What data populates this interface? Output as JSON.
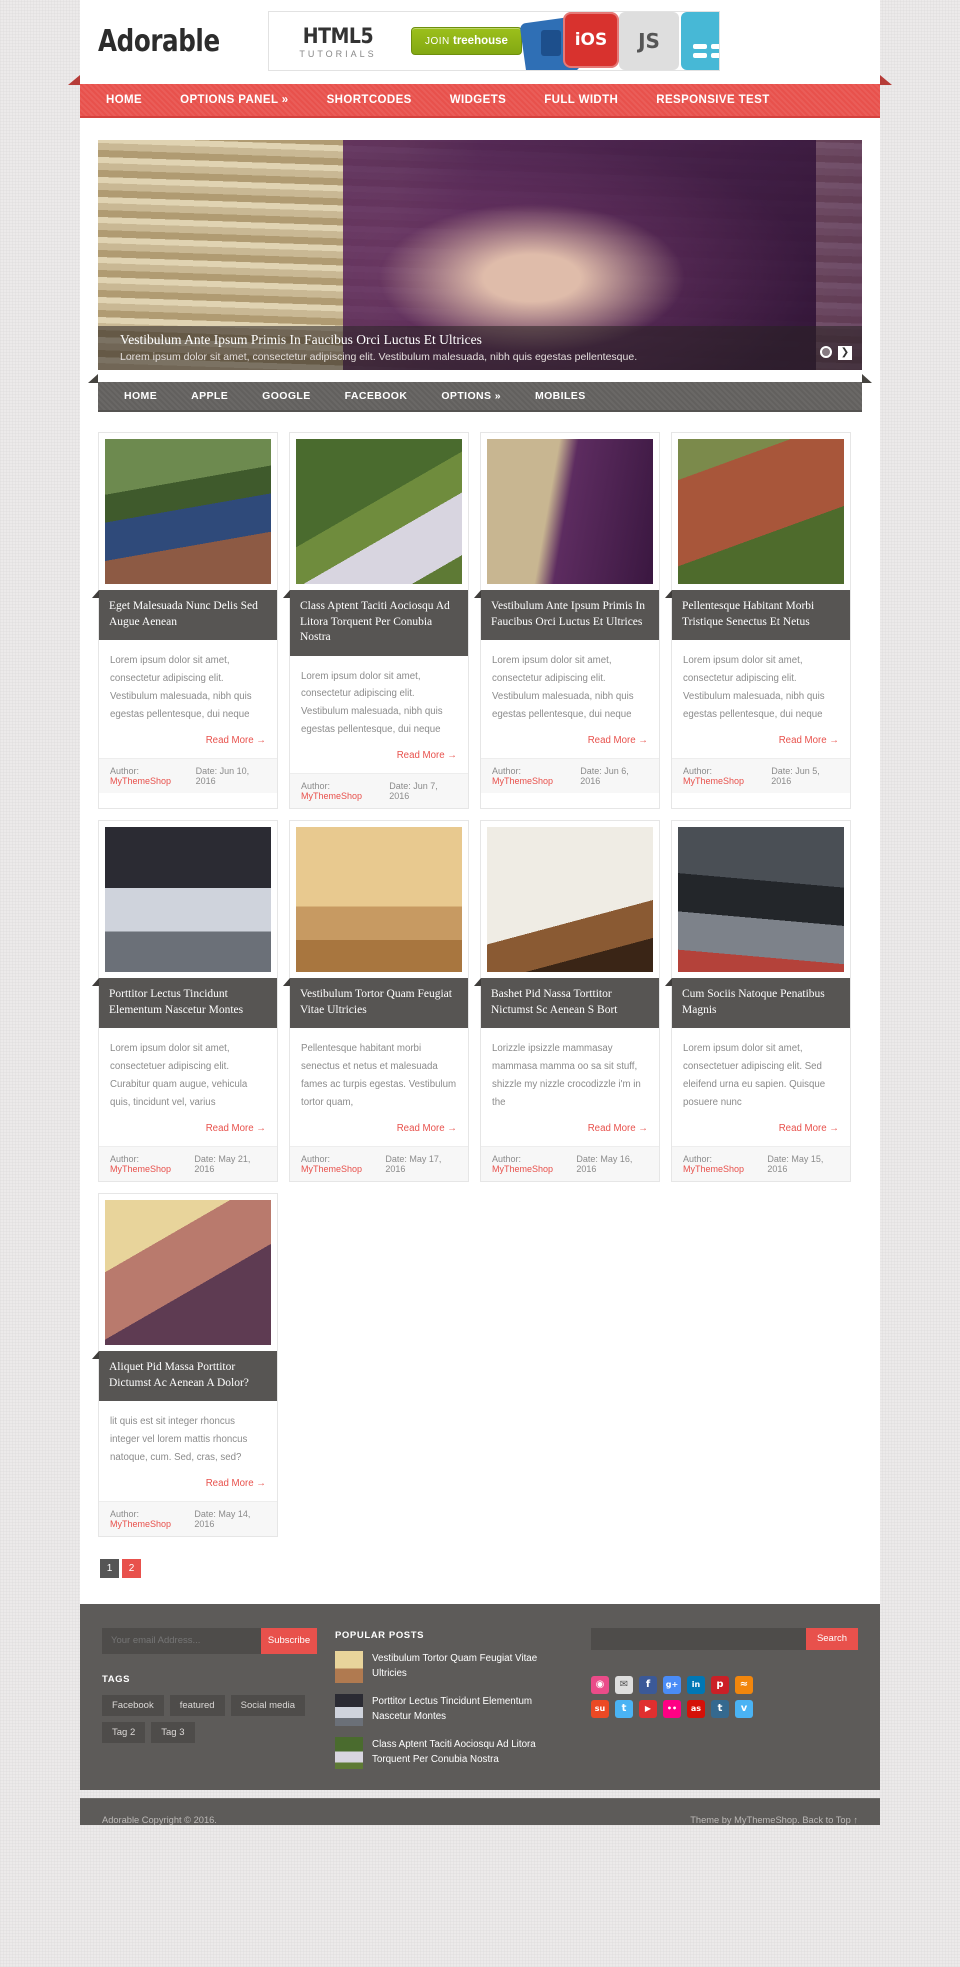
{
  "site": {
    "logo": "Adorable"
  },
  "ad": {
    "title": "HTML5",
    "subtitle": "TUTORIALS",
    "button_pre": "JOIN",
    "button_main": "treehouse",
    "tile_ios": "iOS",
    "tile_js": "JS"
  },
  "main_nav": [
    {
      "label": "HOME"
    },
    {
      "label": "OPTIONS PANEL »"
    },
    {
      "label": "SHORTCODES"
    },
    {
      "label": "WIDGETS"
    },
    {
      "label": "FULL WIDTH"
    },
    {
      "label": "RESPONSIVE TEST"
    }
  ],
  "slider": {
    "title": "Vestibulum Ante Ipsum Primis In Faucibus Orci Luctus Et Ultrices",
    "text": "Lorem ipsum dolor sit amet, consectetur adipiscing elit. Vestibulum malesuada, nibh quis egestas pellentesque.",
    "next": "❯"
  },
  "cat_nav": [
    {
      "label": "HOME"
    },
    {
      "label": "APPLE"
    },
    {
      "label": "GOOGLE"
    },
    {
      "label": "FACEBOOK"
    },
    {
      "label": "OPTIONS »"
    },
    {
      "label": "MOBILES"
    }
  ],
  "posts": [
    {
      "title": "Eget Malesuada Nunc Delis Sed Augue Aenean",
      "excerpt": "Lorem ipsum dolor sit amet, consectetur adipiscing elit. Vestibulum malesuada, nibh quis egestas pellentesque, dui neque",
      "read_more": "Read More →",
      "author_label": "Author:",
      "author": "MyThemeShop",
      "date_label": "Date:",
      "date": "Jun 10, 2016"
    },
    {
      "title": "Class Aptent Taciti Aociosqu Ad Litora Torquent Per Conubia Nostra",
      "excerpt": "Lorem ipsum dolor sit amet, consectetur adipiscing elit. Vestibulum malesuada, nibh quis egestas pellentesque, dui neque",
      "read_more": "Read More →",
      "author_label": "Author:",
      "author": "MyThemeShop",
      "date_label": "Date:",
      "date": "Jun 7, 2016"
    },
    {
      "title": "Vestibulum Ante Ipsum Primis In Faucibus Orci Luctus Et Ultrices",
      "excerpt": "Lorem ipsum dolor sit amet, consectetur adipiscing elit. Vestibulum malesuada, nibh quis egestas pellentesque, dui neque",
      "read_more": "Read More →",
      "author_label": "Author:",
      "author": "MyThemeShop",
      "date_label": "Date:",
      "date": "Jun 6, 2016"
    },
    {
      "title": "Pellentesque Habitant Morbi Tristique Senectus Et Netus",
      "excerpt": "Lorem ipsum dolor sit amet, consectetur adipiscing elit. Vestibulum malesuada, nibh quis egestas pellentesque, dui neque",
      "read_more": "Read More →",
      "author_label": "Author:",
      "author": "MyThemeShop",
      "date_label": "Date:",
      "date": "Jun 5, 2016"
    },
    {
      "title": "Porttitor Lectus Tincidunt Elementum Nascetur Montes",
      "excerpt": "Lorem ipsum dolor sit amet, consectetuer adipiscing elit. Curabitur quam augue, vehicula quis, tincidunt vel, varius",
      "read_more": "Read More →",
      "author_label": "Author:",
      "author": "MyThemeShop",
      "date_label": "Date:",
      "date": "May 21, 2016"
    },
    {
      "title": "Vestibulum Tortor Quam Feugiat Vitae Ultricies",
      "excerpt": "Pellentesque habitant morbi senectus et netus et malesuada fames ac turpis egestas. Vestibulum tortor quam,",
      "read_more": "Read More →",
      "author_label": "Author:",
      "author": "MyThemeShop",
      "date_label": "Date:",
      "date": "May 17, 2016"
    },
    {
      "title": "Bashet Pid Nassa Torttitor Nictumst Sc Aenean S Bort",
      "excerpt": "Lorizzle ipsizzle mammasay mammasa mamma oo sa sit stuff, shizzle my nizzle crocodizzle i'm in the",
      "read_more": "Read More →",
      "author_label": "Author:",
      "author": "MyThemeShop",
      "date_label": "Date:",
      "date": "May 16, 2016"
    },
    {
      "title": "Cum Sociis Natoque Penatibus Magnis",
      "excerpt": "Lorem ipsum dolor sit amet, consectetuer adipiscing elit. Sed eleifend urna eu sapien. Quisque posuere nunc",
      "read_more": "Read More →",
      "author_label": "Author:",
      "author": "MyThemeShop",
      "date_label": "Date:",
      "date": "May 15, 2016"
    },
    {
      "title": "Aliquet Pid Massa Porttitor Dictumst Ac Aenean A Dolor?",
      "excerpt": "lit quis est sit integer rhoncus integer vel lorem mattis rhoncus natoque, cum. Sed, cras, sed?",
      "read_more": "Read More →",
      "author_label": "Author:",
      "author": "MyThemeShop",
      "date_label": "Date:",
      "date": "May 14, 2016"
    }
  ],
  "pagination": {
    "pages": [
      "1",
      "2"
    ],
    "active": "2"
  },
  "footer": {
    "subscribe": {
      "placeholder": "Your email Address...",
      "button": "Subscribe"
    },
    "tags_title": "TAGS",
    "tags": [
      "Facebook",
      "featured",
      "Social media",
      "Tag 2",
      "Tag 3"
    ],
    "popular_title": "POPULAR POSTS",
    "popular": [
      {
        "title": "Vestibulum Tortor Quam Feugiat Vitae Ultricies"
      },
      {
        "title": "Porttitor Lectus Tincidunt Elementum Nascetur Montes"
      },
      {
        "title": "Class Aptent Taciti Aociosqu Ad Litora Torquent Per Conubia Nostra"
      }
    ],
    "search": {
      "value": "",
      "placeholder": "",
      "button": "Search"
    },
    "socials": [
      {
        "name": "dribbble-icon",
        "glyph": "◉",
        "color": "#ea4c89"
      },
      {
        "name": "email-icon",
        "glyph": "✉",
        "color": "#dedede"
      },
      {
        "name": "facebook-icon",
        "glyph": "f",
        "color": "#3b5998"
      },
      {
        "name": "googleplus-icon",
        "glyph": "g+",
        "color": "#4a8cf7"
      },
      {
        "name": "linkedin-icon",
        "glyph": "in",
        "color": "#0077b5"
      },
      {
        "name": "pinterest-icon",
        "glyph": "p",
        "color": "#cb2027"
      },
      {
        "name": "rss-icon",
        "glyph": "≈",
        "color": "#f2860c"
      },
      {
        "name": "stumbleupon-icon",
        "glyph": "su",
        "color": "#eb4924"
      },
      {
        "name": "twitter-icon",
        "glyph": "t",
        "color": "#4ab3f4"
      },
      {
        "name": "youtube-icon",
        "glyph": "▶",
        "color": "#e02f2f"
      },
      {
        "name": "flickr-icon",
        "glyph": "••",
        "color": "#ff0084"
      },
      {
        "name": "lastfm-icon",
        "glyph": "as",
        "color": "#d51007"
      },
      {
        "name": "tumblr-icon",
        "glyph": "t",
        "color": "#35698f"
      },
      {
        "name": "vimeo-icon",
        "glyph": "v",
        "color": "#4ab3f4"
      }
    ],
    "copyright": "Adorable Copyright © 2016.",
    "credit": "Theme by MyThemeShop.",
    "back_to_top": "Back to Top ↑"
  },
  "colors": {
    "accent": "#e8514c",
    "dark": "#5d5b59",
    "title_bg": "#575553"
  }
}
